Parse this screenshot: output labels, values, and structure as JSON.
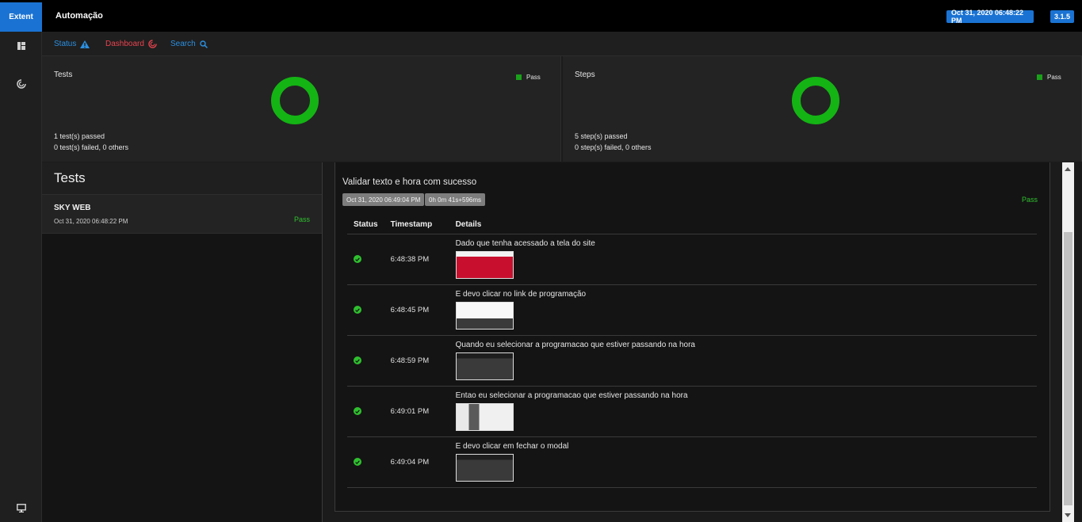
{
  "header": {
    "brand": "Extent",
    "title": "Automação",
    "timestamp": "Oct 31, 2020 06:48:22 PM",
    "version": "3.1.5"
  },
  "nav": {
    "status": "Status",
    "dashboard": "Dashboard",
    "search": "Search"
  },
  "summary": {
    "tests": {
      "title": "Tests",
      "legend": "Pass",
      "passed_line": "1 test(s) passed",
      "failed_line": "0 test(s) failed, 0 others"
    },
    "steps": {
      "title": "Steps",
      "legend": "Pass",
      "passed_line": "5 step(s) passed",
      "failed_line": "0 step(s) failed, 0 others"
    },
    "pass_color": "#14b414"
  },
  "test_list": {
    "heading": "Tests",
    "items": [
      {
        "name": "SKY WEB",
        "date": "Oct 31, 2020 06:48:22 PM",
        "status": "Pass"
      }
    ]
  },
  "detail": {
    "title": "Validar texto e hora com sucesso",
    "start_time": "Oct 31, 2020 06:49:04 PM",
    "duration": "0h 0m 41s+596ms",
    "status": "Pass",
    "columns": {
      "status": "Status",
      "timestamp": "Timestamp",
      "details": "Details"
    },
    "steps": [
      {
        "time": "6:48:38 PM",
        "text": "Dado que tenha acessado a tela do site",
        "thumb": "red"
      },
      {
        "time": "6:48:45 PM",
        "text": "E devo clicar no link de programação",
        "thumb": "white"
      },
      {
        "time": "6:48:59 PM",
        "text": "Quando eu selecionar a programacao que estiver passando na hora",
        "thumb": "dark"
      },
      {
        "time": "6:49:01 PM",
        "text": "Entao eu selecionar a programacao que estiver passando na hora",
        "thumb": "modal"
      },
      {
        "time": "6:49:04 PM",
        "text": "E devo clicar em fechar o modal",
        "thumb": "dark"
      }
    ]
  }
}
